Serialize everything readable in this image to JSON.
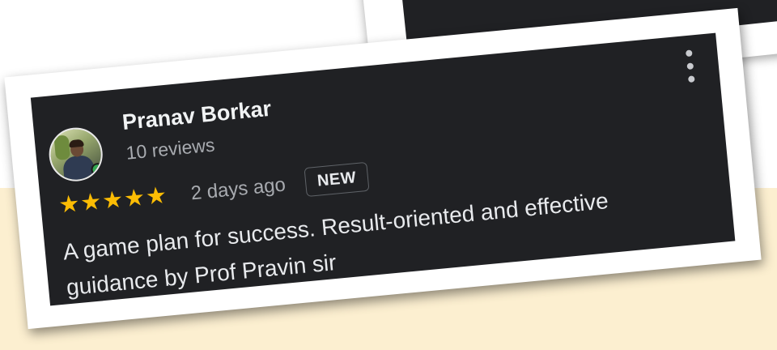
{
  "review": {
    "author": "Pranav Borkar",
    "reviews_count": "10 reviews",
    "rating": 5,
    "stars": "★★★★★",
    "time": "2 days ago",
    "badge": "NEW",
    "text": "A game plan for success. Result-oriented and effective guidance by Prof Pravin sir"
  },
  "icons": {
    "menu": "more-vert-icon",
    "star": "star-icon"
  },
  "colors": {
    "card_background": "#202124",
    "star": "#fbbc04",
    "secondary_text": "#a8abb0",
    "background_band": "#fcefd0"
  }
}
